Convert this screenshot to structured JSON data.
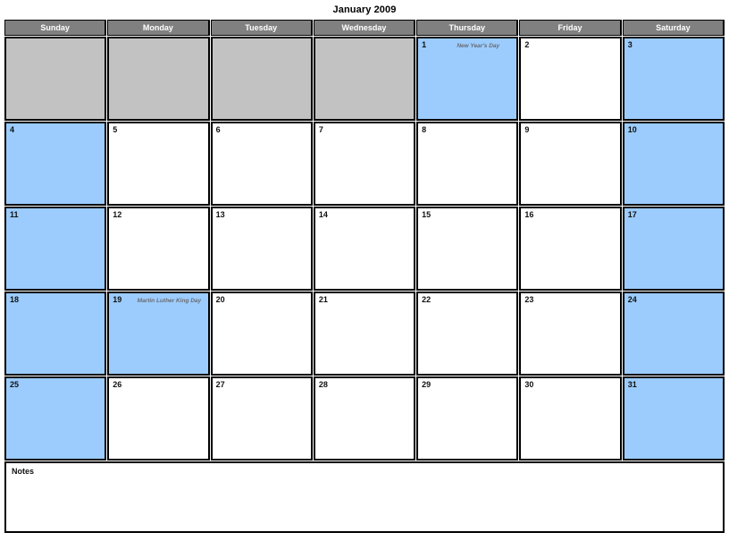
{
  "title": "January 2009",
  "colors": {
    "header_bg": "#808080",
    "header_text": "#FFFFFF",
    "weekend_bg": "#9BCCFD",
    "blank_bg": "#C2C2C2",
    "weekday_bg": "#FFFFFF",
    "border": "#000000",
    "holiday_text": "#6B6B72"
  },
  "weekdays": [
    {
      "label": "Sunday"
    },
    {
      "label": "Monday"
    },
    {
      "label": "Tuesday"
    },
    {
      "label": "Wednesday"
    },
    {
      "label": "Thursday"
    },
    {
      "label": "Friday"
    },
    {
      "label": "Saturday"
    }
  ],
  "weeks": [
    [
      {
        "day": "",
        "holiday": "",
        "kind": "blank"
      },
      {
        "day": "",
        "holiday": "",
        "kind": "blank"
      },
      {
        "day": "",
        "holiday": "",
        "kind": "blank"
      },
      {
        "day": "",
        "holiday": "",
        "kind": "blank"
      },
      {
        "day": "1",
        "holiday": "New Year's Day",
        "kind": "weekend"
      },
      {
        "day": "2",
        "holiday": "",
        "kind": "weekday"
      },
      {
        "day": "3",
        "holiday": "",
        "kind": "weekend"
      }
    ],
    [
      {
        "day": "4",
        "holiday": "",
        "kind": "weekend"
      },
      {
        "day": "5",
        "holiday": "",
        "kind": "weekday"
      },
      {
        "day": "6",
        "holiday": "",
        "kind": "weekday"
      },
      {
        "day": "7",
        "holiday": "",
        "kind": "weekday"
      },
      {
        "day": "8",
        "holiday": "",
        "kind": "weekday"
      },
      {
        "day": "9",
        "holiday": "",
        "kind": "weekday"
      },
      {
        "day": "10",
        "holiday": "",
        "kind": "weekend"
      }
    ],
    [
      {
        "day": "11",
        "holiday": "",
        "kind": "weekend"
      },
      {
        "day": "12",
        "holiday": "",
        "kind": "weekday"
      },
      {
        "day": "13",
        "holiday": "",
        "kind": "weekday"
      },
      {
        "day": "14",
        "holiday": "",
        "kind": "weekday"
      },
      {
        "day": "15",
        "holiday": "",
        "kind": "weekday"
      },
      {
        "day": "16",
        "holiday": "",
        "kind": "weekday"
      },
      {
        "day": "17",
        "holiday": "",
        "kind": "weekend"
      }
    ],
    [
      {
        "day": "18",
        "holiday": "",
        "kind": "weekend"
      },
      {
        "day": "19",
        "holiday": "Martin Luther King Day",
        "kind": "weekend"
      },
      {
        "day": "20",
        "holiday": "",
        "kind": "weekday"
      },
      {
        "day": "21",
        "holiday": "",
        "kind": "weekday"
      },
      {
        "day": "22",
        "holiday": "",
        "kind": "weekday"
      },
      {
        "day": "23",
        "holiday": "",
        "kind": "weekday"
      },
      {
        "day": "24",
        "holiday": "",
        "kind": "weekend"
      }
    ],
    [
      {
        "day": "25",
        "holiday": "",
        "kind": "weekend"
      },
      {
        "day": "26",
        "holiday": "",
        "kind": "weekday"
      },
      {
        "day": "27",
        "holiday": "",
        "kind": "weekday"
      },
      {
        "day": "28",
        "holiday": "",
        "kind": "weekday"
      },
      {
        "day": "29",
        "holiday": "",
        "kind": "weekday"
      },
      {
        "day": "30",
        "holiday": "",
        "kind": "weekday"
      },
      {
        "day": "31",
        "holiday": "",
        "kind": "weekend"
      }
    ]
  ],
  "notes": {
    "label": "Notes",
    "value": ""
  }
}
